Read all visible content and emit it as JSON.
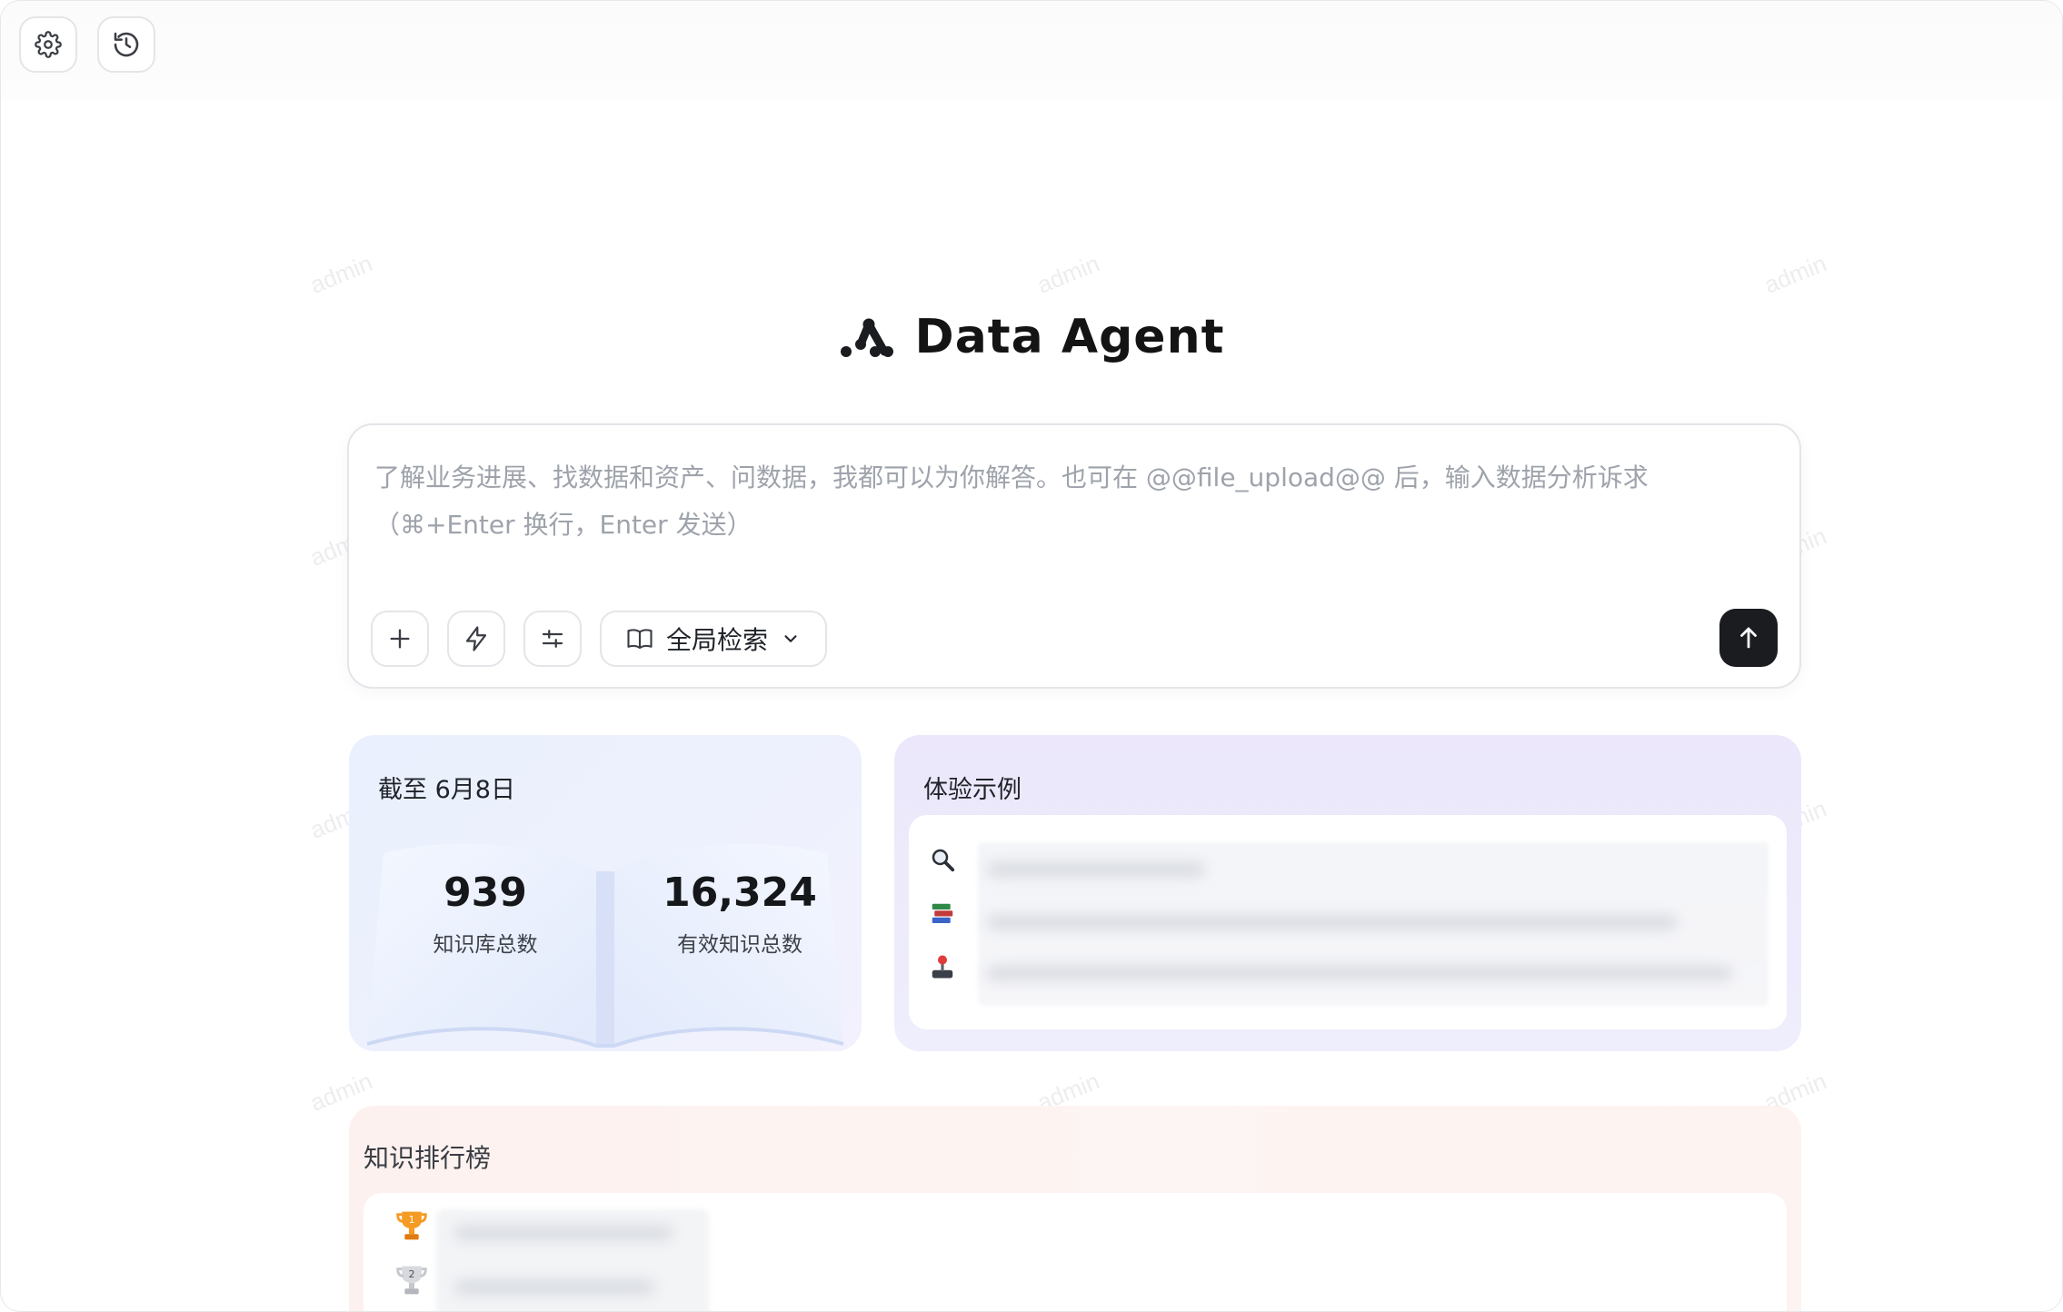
{
  "watermark": "admin",
  "toolbar": {
    "settings_icon": "gear-icon",
    "history_icon": "history-icon"
  },
  "brand": {
    "title": "Data Agent"
  },
  "input": {
    "placeholder": "了解业务进展、找数据和资产、问数据，我都可以为你解答。也可在 @@file_upload@@ 后，输入数据分析诉求（⌘+Enter 换行，Enter 发送）",
    "scope_label": "全局检索"
  },
  "stats": {
    "title": "截至 6月8日",
    "kb_total": "939",
    "kb_total_label": "知识库总数",
    "valid_total": "16,324",
    "valid_total_label": "有效知识总数"
  },
  "examples": {
    "title": "体验示例",
    "icons": [
      "magnifier-icon",
      "books-icon",
      "joystick-icon"
    ]
  },
  "ranking": {
    "title": "知识排行榜",
    "ranks": [
      "1",
      "2"
    ]
  },
  "colors": {
    "send_button": "#1a1c1f",
    "stats_bg": "#eaf0fd",
    "examples_bg": "#ece7fb",
    "ranking_bg": "#fdf1ef"
  }
}
